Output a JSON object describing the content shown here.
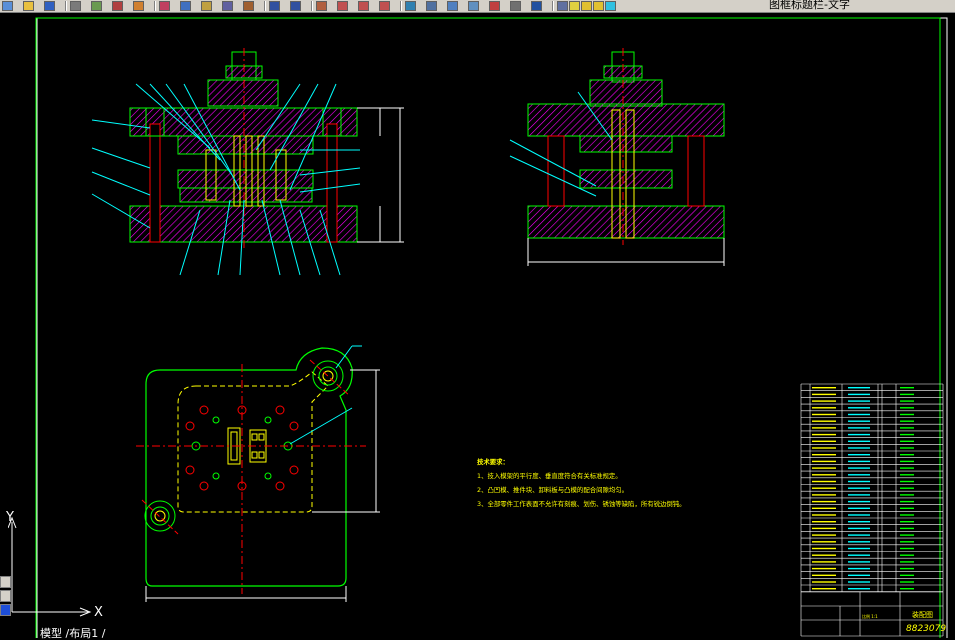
{
  "toolbar": {
    "icons": [
      "new-icon",
      "open-icon",
      "save-icon",
      "print-icon",
      "preview-icon",
      "publish-icon",
      "3d-print-icon",
      "cut-icon",
      "copy-icon",
      "paste-icon",
      "match-properties-icon",
      "brush-icon",
      "undo-icon",
      "redo-icon",
      "pan-icon",
      "zoom-realtime-icon",
      "zoom-window-icon",
      "zoom-previous-icon",
      "properties-icon",
      "design-center-icon",
      "tool-palettes-icon",
      "sheet-set-icon",
      "markup-icon",
      "calculator-icon",
      "help-icon",
      "layer-manager-icon",
      "layer-bulb-icon",
      "layer-sun-icon",
      "layer-lock-icon",
      "layer-color-icon"
    ],
    "layer_name": "图框标题栏-文字"
  },
  "drawing": {
    "technical_requirements": {
      "title": "技术要求：",
      "items": [
        "1、技入模架的平行度、垂直度符合有关标准规定。",
        "2、凸凹模、推件块、卸料板与凸模的配合间隙均匀。",
        "3、全部零件工作表面不允许有刻痕、划伤、锈蚀等缺陷，所有锐边倒钝。"
      ]
    },
    "title_block": {
      "drawing_name": "装配图",
      "drawing_number": "8823079",
      "sheet_scale": "比例 1:1"
    }
  },
  "ucs": {
    "x_label": "X",
    "y_label": "Y"
  },
  "status": {
    "layout_tabs": "模型 /布局1 /"
  },
  "colors": {
    "background": "#000000",
    "outline": "#00ff00",
    "hatch": "#ff00ff",
    "centerline": "#ff0000",
    "dimension": "#ffffff",
    "leader": "#00ffff",
    "text": "#ffff00",
    "toolbar": "#d4d0c8"
  }
}
